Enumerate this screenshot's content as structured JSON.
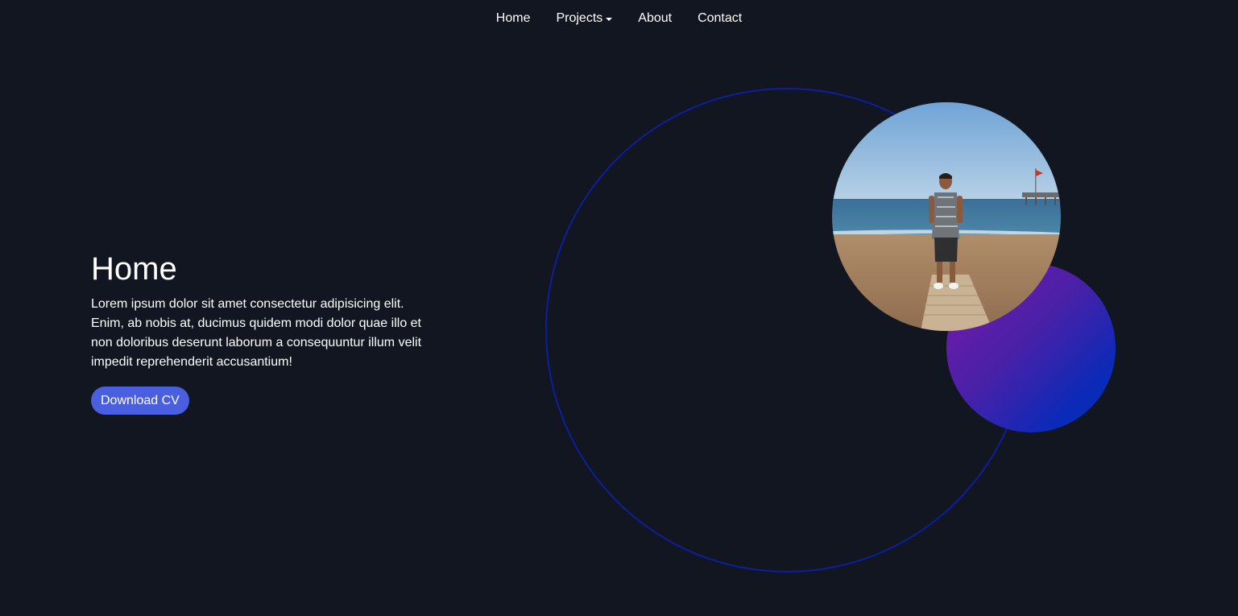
{
  "nav": {
    "items": [
      {
        "label": "Home"
      },
      {
        "label": "Projects"
      },
      {
        "label": "About"
      },
      {
        "label": "Contact"
      }
    ]
  },
  "hero": {
    "title": "Home",
    "description": "Lorem ipsum dolor sit amet consectetur adipisicing elit. Enim, ab nobis at, ducimus quidem modi dolor quae illo et non doloribus deserunt laborum a consequuntur illum velit impedit reprehenderit accusantium!",
    "button_label": "Download CV"
  },
  "colors": {
    "background": "#111621",
    "accent_button": "#4a5fe0",
    "ring": "#0d1f9c",
    "gradient_start": "#7a1aa8",
    "gradient_end": "#0532b8"
  },
  "icons": {
    "projects_dropdown": "caret-down-icon"
  }
}
